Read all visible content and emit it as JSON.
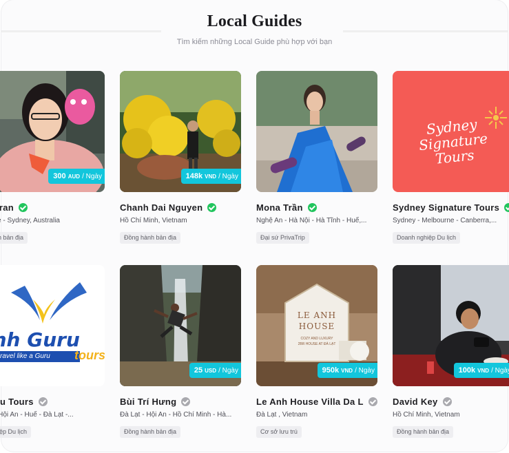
{
  "header": {
    "title": "Local Guides",
    "subtitle": "Tìm kiếm những Local Guide phù hợp với bạn"
  },
  "colors": {
    "price_badge": "#12c6dc",
    "verified": "#22c55e",
    "unverified": "#a9a9ae"
  },
  "guides": [
    {
      "name": "ia Tran",
      "verified": true,
      "location": "ourne - Sydney, Australia",
      "tag": "hành bản địa",
      "price": "300",
      "currency": "AUD",
      "per": "/ Ngày"
    },
    {
      "name": "Chanh Dai Nguyen",
      "verified": true,
      "location": "Hồ Chí Minh, Vietnam",
      "tag": "Đồng hành bản địa",
      "price": "148k",
      "currency": "VND",
      "per": "/ Ngày"
    },
    {
      "name": "Mona Trần",
      "verified": true,
      "location": "Nghệ An - Hà Nội - Hà Tĩnh - Huế,...",
      "tag": "Đại sứ PrivaTrip"
    },
    {
      "name": "Sydney Signature Tours",
      "verified": true,
      "location": "Sydney - Melbourne - Canberra,...",
      "tag": "Doanh nghiệp Du lịch",
      "logo_text": "Sydney Signature Tours"
    },
    {
      "name": "Guru Tours",
      "verified": false,
      "location": "An - Hội An - Huế - Đà Lạt -...",
      "tag": "nghiệp Du lịch",
      "logo_text": "inh Guru",
      "slogan": "ravel like a Guru",
      "slogan_word": "tours"
    },
    {
      "name": "Bùi Trí Hưng",
      "verified": false,
      "location": "Đà Lạt - Hội An - Hồ Chí Minh - Hà...",
      "tag": "Đồng hành bản địa",
      "price": "25",
      "currency": "USD",
      "per": "/ Ngày"
    },
    {
      "name": "Le Anh House Villa Da L...",
      "verified": false,
      "location": "Đà Lạt , Vietnam",
      "tag": "Cơ sở lưu trú",
      "price": "950k",
      "currency": "VND",
      "per": "/ Ngày",
      "sign_line1": "LE ANH",
      "sign_line2": "HOUSE",
      "sign_sub1": "COZY AND LUXURY",
      "sign_sub2": "2BR HOUSE AT ĐÀ LẠT"
    },
    {
      "name": "David Key",
      "verified": false,
      "location": "Hồ Chí Minh, Vietnam",
      "tag": "Đồng hành bản địa",
      "price": "100k",
      "currency": "VND",
      "per": "/ Ngày"
    }
  ]
}
